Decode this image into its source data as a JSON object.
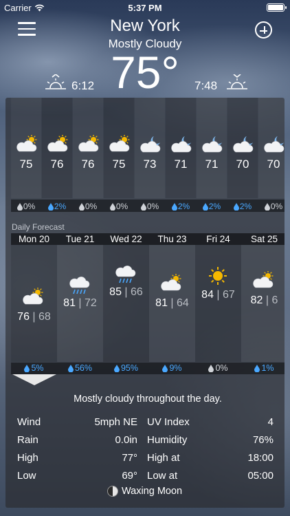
{
  "status_bar": {
    "carrier": "Carrier",
    "time": "5:37 PM"
  },
  "header": {
    "city": "New York",
    "condition": "Mostly Cloudy",
    "temperature": "75°",
    "sunrise": "6:12",
    "sunset": "7:48"
  },
  "hourly": [
    {
      "temp": "75",
      "precip": "0%",
      "icon": "partly-cloudy-day-icon",
      "precip_color": "grey"
    },
    {
      "temp": "76",
      "precip": "2%",
      "icon": "partly-cloudy-day-icon",
      "precip_color": "blue"
    },
    {
      "temp": "76",
      "precip": "0%",
      "icon": "partly-cloudy-day-icon",
      "precip_color": "grey"
    },
    {
      "temp": "75",
      "precip": "0%",
      "icon": "partly-cloudy-day-icon",
      "precip_color": "grey"
    },
    {
      "temp": "73",
      "precip": "0%",
      "icon": "partly-cloudy-night-icon",
      "precip_color": "grey"
    },
    {
      "temp": "71",
      "precip": "2%",
      "icon": "partly-cloudy-night-icon",
      "precip_color": "blue"
    },
    {
      "temp": "71",
      "precip": "2%",
      "icon": "partly-cloudy-night-icon",
      "precip_color": "blue"
    },
    {
      "temp": "70",
      "precip": "2%",
      "icon": "partly-cloudy-night-icon",
      "precip_color": "blue"
    },
    {
      "temp": "70",
      "precip": "0%",
      "icon": "partly-cloudy-night-icon",
      "precip_color": "grey"
    }
  ],
  "daily": {
    "section_label": "Daily Forecast",
    "days": [
      {
        "name": "Mon 20",
        "high": "76",
        "low": "68",
        "precip": "5%",
        "icon": "partly-cloudy-day-icon",
        "precip_color": "blue",
        "selected": true
      },
      {
        "name": "Tue 21",
        "high": "81",
        "low": "72",
        "precip": "56%",
        "icon": "rain-icon",
        "precip_color": "blue"
      },
      {
        "name": "Wed 22",
        "high": "85",
        "low": "66",
        "precip": "95%",
        "icon": "rain-icon",
        "precip_color": "blue"
      },
      {
        "name": "Thu 23",
        "high": "81",
        "low": "64",
        "precip": "9%",
        "icon": "partly-cloudy-day-icon",
        "precip_color": "blue"
      },
      {
        "name": "Fri 24",
        "high": "84",
        "low": "67",
        "precip": "0%",
        "icon": "sun-icon",
        "precip_color": "grey"
      },
      {
        "name": "Sat 25",
        "high": "82",
        "low": "6",
        "precip": "1%",
        "icon": "partly-cloudy-day-icon",
        "precip_color": "blue"
      }
    ]
  },
  "details": {
    "summary": "Mostly cloudy throughout the day.",
    "rows": [
      {
        "label": "Wind",
        "value": "5mph NE",
        "label2": "UV Index",
        "value2": "4"
      },
      {
        "label": "Rain",
        "value": "0.0in",
        "label2": "Humidity",
        "value2": "76%"
      },
      {
        "label": "High",
        "value": "77°",
        "label2": "High at",
        "value2": "18:00"
      },
      {
        "label": "Low",
        "value": "69°",
        "label2": "Low at",
        "value2": "05:00"
      }
    ],
    "moon_phase": "Waxing Moon"
  },
  "colors": {
    "precip_blue": "#4aa8ff",
    "sun_yellow": "#f5b800"
  }
}
